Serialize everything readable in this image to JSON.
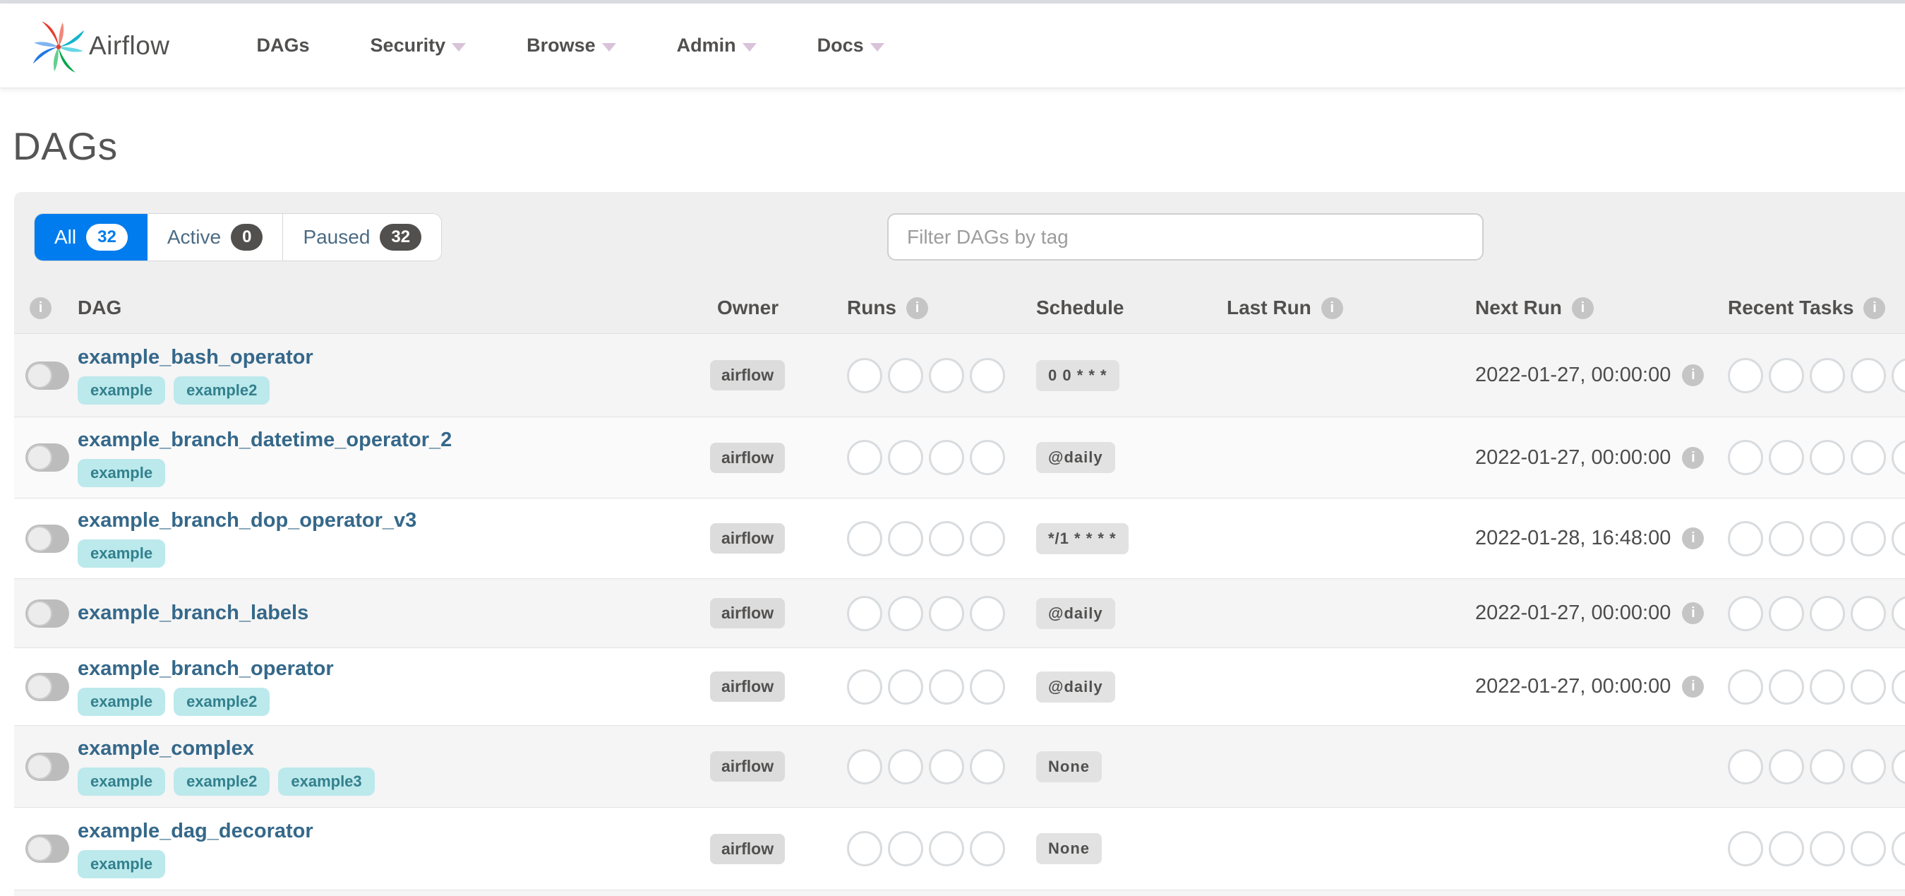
{
  "nav": {
    "brand": "Airflow",
    "items": [
      {
        "label": "DAGs",
        "caret": false
      },
      {
        "label": "Security",
        "caret": true
      },
      {
        "label": "Browse",
        "caret": true
      },
      {
        "label": "Admin",
        "caret": true
      },
      {
        "label": "Docs",
        "caret": true
      }
    ]
  },
  "page": {
    "title": "DAGs"
  },
  "toolbar": {
    "tabs": [
      {
        "label": "All",
        "count": "32",
        "active": true
      },
      {
        "label": "Active",
        "count": "0",
        "active": false
      },
      {
        "label": "Paused",
        "count": "32",
        "active": false
      }
    ],
    "filter_placeholder": "Filter DAGs by tag",
    "filter_value": ""
  },
  "table": {
    "columns": [
      {
        "label": "",
        "info": true,
        "key": "toggle"
      },
      {
        "label": "DAG",
        "info": false,
        "key": "dag"
      },
      {
        "label": "Owner",
        "info": false,
        "key": "owner"
      },
      {
        "label": "Runs",
        "info": true,
        "key": "runs"
      },
      {
        "label": "Schedule",
        "info": false,
        "key": "schedule"
      },
      {
        "label": "Last Run",
        "info": true,
        "key": "lastrun"
      },
      {
        "label": "Next Run",
        "info": true,
        "key": "nextrun"
      },
      {
        "label": "Recent Tasks",
        "info": true,
        "key": "recent"
      }
    ],
    "rows": [
      {
        "name": "example_bash_operator",
        "tags": [
          "example",
          "example2"
        ],
        "owner": "airflow",
        "toggle_on": false,
        "runs_circles": 4,
        "schedule": "0 0 * * *",
        "last_run": "",
        "next_run": "2022-01-27, 00:00:00",
        "recent_circles": 5,
        "bg": "#f5f5f5"
      },
      {
        "name": "example_branch_datetime_operator_2",
        "tags": [
          "example"
        ],
        "owner": "airflow",
        "toggle_on": false,
        "runs_circles": 4,
        "schedule": "@daily",
        "last_run": "",
        "next_run": "2022-01-27, 00:00:00",
        "recent_circles": 5,
        "bg": "#fafafa"
      },
      {
        "name": "example_branch_dop_operator_v3",
        "tags": [
          "example"
        ],
        "owner": "airflow",
        "toggle_on": false,
        "runs_circles": 4,
        "schedule": "*/1 * * * *",
        "last_run": "",
        "next_run": "2022-01-28, 16:48:00",
        "recent_circles": 5,
        "bg": "#ffffff"
      },
      {
        "name": "example_branch_labels",
        "tags": [],
        "owner": "airflow",
        "toggle_on": false,
        "runs_circles": 4,
        "schedule": "@daily",
        "last_run": "",
        "next_run": "2022-01-27, 00:00:00",
        "recent_circles": 5,
        "bg": "#f5f5f5"
      },
      {
        "name": "example_branch_operator",
        "tags": [
          "example",
          "example2"
        ],
        "owner": "airflow",
        "toggle_on": false,
        "runs_circles": 4,
        "schedule": "@daily",
        "last_run": "",
        "next_run": "2022-01-27, 00:00:00",
        "recent_circles": 5,
        "bg": "#ffffff"
      },
      {
        "name": "example_complex",
        "tags": [
          "example",
          "example2",
          "example3"
        ],
        "owner": "airflow",
        "toggle_on": false,
        "runs_circles": 4,
        "schedule": "None",
        "last_run": "",
        "next_run": "",
        "recent_circles": 5,
        "bg": "#f5f5f5"
      },
      {
        "name": "example_dag_decorator",
        "tags": [
          "example"
        ],
        "owner": "airflow",
        "toggle_on": false,
        "runs_circles": 4,
        "schedule": "None",
        "last_run": "",
        "next_run": "",
        "recent_circles": 5,
        "bg": "#ffffff"
      }
    ]
  },
  "colors": {
    "accent_blue": "#017cee",
    "nav_text": "#51504f",
    "dag_link": "#35688a",
    "tag_bg": "#bce9ec",
    "tag_text": "#33808d",
    "badge_bg": "#dcdcdc",
    "panel_bg": "#efefef",
    "stripe_bg": "#f5f5f5",
    "count_badge_bg": "#51504f",
    "logo_red": "#e43f2c",
    "logo_teal": "#12b5cb",
    "logo_green": "#00a64a",
    "logo_blue": "#2077e6"
  }
}
